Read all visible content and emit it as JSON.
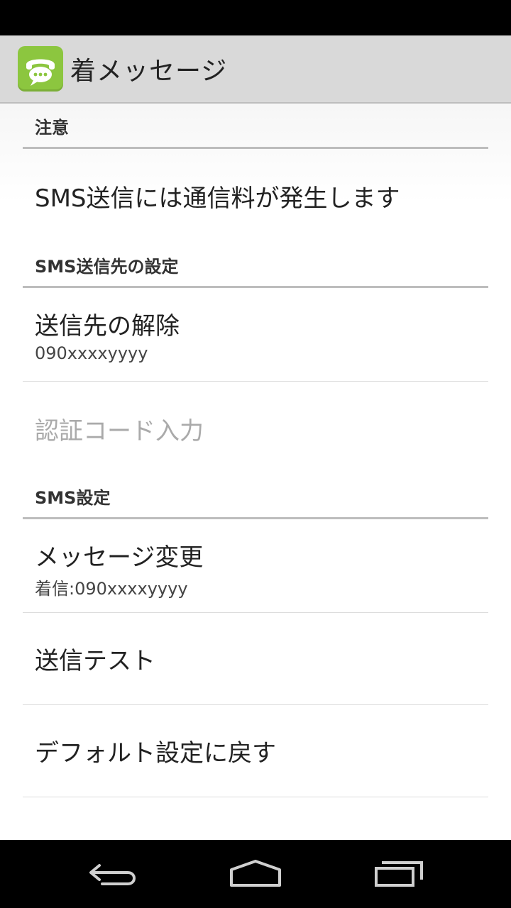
{
  "app": {
    "title": "着メッセージ",
    "icon": "phone-chat-icon",
    "accent_color": "#8cc63f"
  },
  "sections": {
    "caution": {
      "header": "注意",
      "notice": "SMS送信には通信料が発生します"
    },
    "destination": {
      "header": "SMS送信先の設定",
      "unregister_title": "送信先の解除",
      "unregister_summary": "090xxxxyyyy",
      "auth_code_title": "認証コード入力"
    },
    "sms": {
      "header": "SMS設定",
      "change_message_title": "メッセージ変更",
      "change_message_summary": "着信:090xxxxyyyy",
      "send_test_title": "送信テスト",
      "reset_defaults_title": "デフォルト設定に戻す"
    }
  },
  "navigation": {
    "back_icon": "back-icon",
    "home_icon": "home-icon",
    "recents_icon": "recents-icon"
  }
}
